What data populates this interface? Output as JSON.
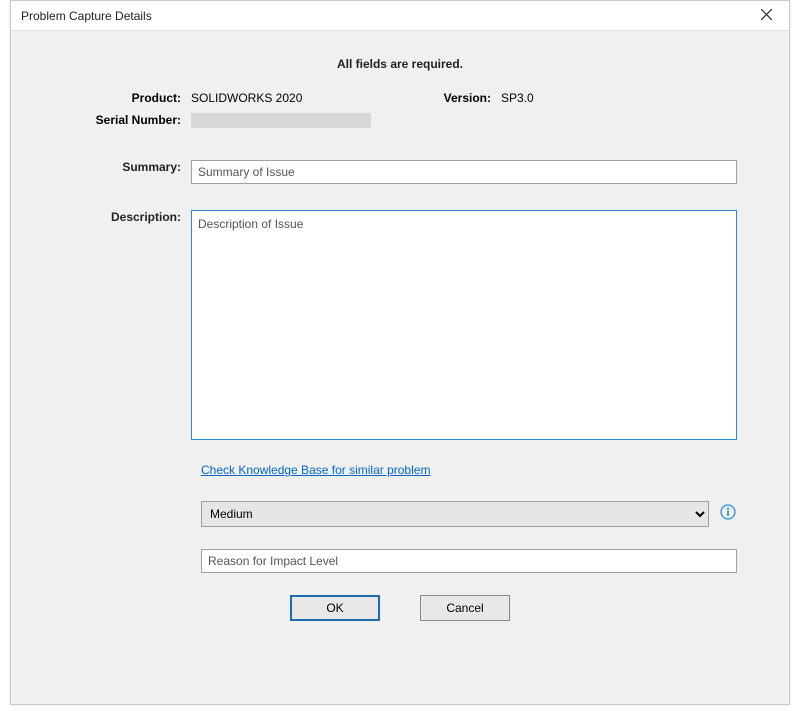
{
  "window": {
    "title": "Problem Capture Details"
  },
  "header": {
    "required_notice": "All fields are required."
  },
  "info": {
    "product_label": "Product:",
    "product_value": "SOLIDWORKS 2020",
    "version_label": "Version:",
    "version_value": "SP3.0",
    "serial_label": "Serial Number:"
  },
  "fields": {
    "summary_label": "Summary:",
    "summary_value": "Summary of Issue",
    "description_label": "Description:",
    "description_value": "Description of Issue",
    "kb_link": "Check Knowledge Base for similar problem",
    "impact_value": "Medium",
    "impact_reason_value": "Reason for Impact Level"
  },
  "buttons": {
    "ok": "OK",
    "cancel": "Cancel"
  }
}
